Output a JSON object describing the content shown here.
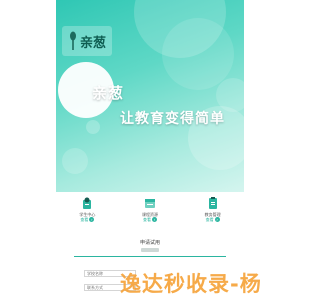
{
  "hero": {
    "logo_text": "亲葱",
    "brand": "亲葱",
    "tagline": "让教育变得简单"
  },
  "features": [
    {
      "icon": "student-center-icon",
      "label": "学生中心",
      "link": "查看"
    },
    {
      "icon": "course-resource-icon",
      "label": "课程资源",
      "link": "查看"
    },
    {
      "icon": "homework-clipboard-icon",
      "label": "教务管理",
      "link": "查看"
    }
  ],
  "trial": {
    "title": "申请试用",
    "field1_placeholder": "学校名称",
    "field2_placeholder": "联系方式"
  },
  "watermark": "逸达秒收录-杨",
  "colors": {
    "accent": "#2bb5a0",
    "hero_top": "#2fc7b4",
    "hero_bottom": "#d5f5ef",
    "watermark": "#f6a33a"
  }
}
